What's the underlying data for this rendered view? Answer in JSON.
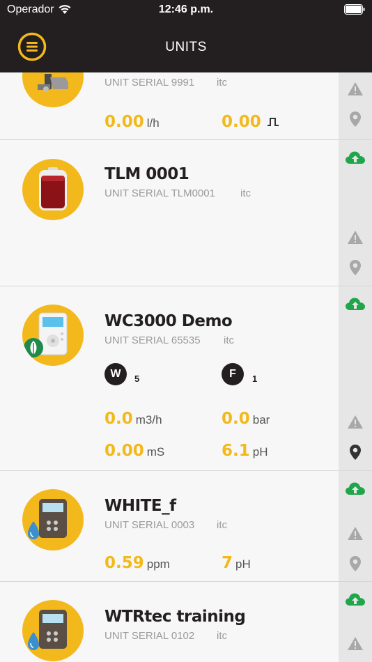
{
  "status_bar": {
    "carrier": "Operador",
    "time": "12:46 p.m."
  },
  "header": {
    "title": "UNITS"
  },
  "units": [
    {
      "name": "",
      "serial": "UNIT SERIAL 9991",
      "owner": "itc",
      "metrics": [
        {
          "value": "0.00",
          "unit": "l/h"
        },
        {
          "value": "0.00",
          "unit": "pulse"
        }
      ]
    },
    {
      "name": "TLM 0001",
      "serial": "UNIT SERIAL TLM0001",
      "owner": "itc",
      "metrics": []
    },
    {
      "name": "WC3000 Demo",
      "serial": "UNIT SERIAL 65535",
      "owner": "itc",
      "badges": [
        {
          "letter": "W",
          "count": "5"
        },
        {
          "letter": "F",
          "count": "1"
        }
      ],
      "metrics": [
        {
          "value": "0.0",
          "unit": "m3/h"
        },
        {
          "value": "0.0",
          "unit": "bar"
        },
        {
          "value": "0.00",
          "unit": "mS"
        },
        {
          "value": "6.1",
          "unit": "pH"
        }
      ]
    },
    {
      "name": "WHITE_f",
      "serial": "UNIT SERIAL 0003",
      "owner": "itc",
      "metrics": [
        {
          "value": "0.59",
          "unit": "ppm"
        },
        {
          "value": "7",
          "unit": "pH"
        }
      ]
    },
    {
      "name": "WTRtec training",
      "serial": "UNIT SERIAL 0102",
      "owner": "itc",
      "metrics": []
    }
  ],
  "colors": {
    "accent": "#f3b91c",
    "header": "#231f20",
    "cloud": "#1fa64a",
    "icon_gray": "#a8a8a8"
  }
}
